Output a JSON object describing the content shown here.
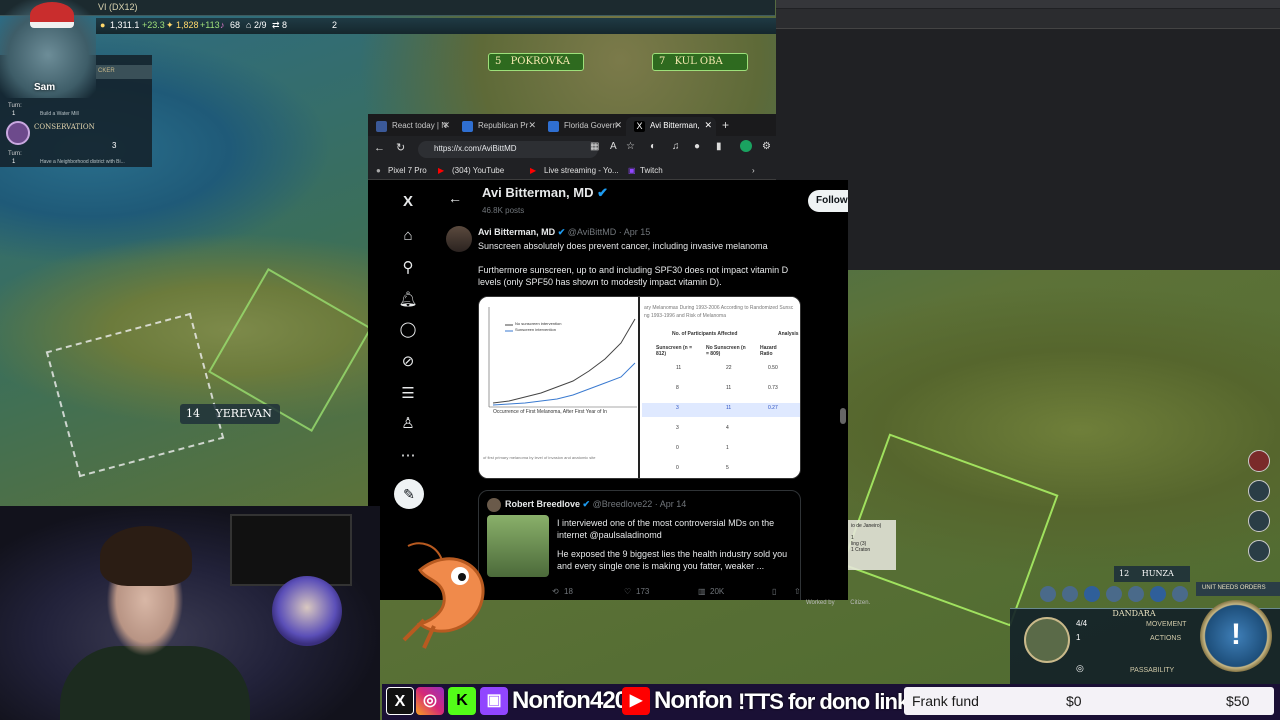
{
  "top_bar": {
    "window_title": "VI (DX12)",
    "gold": "1,311.1",
    "gold_rate": "+23.3",
    "faith": "1,828",
    "faith_rate": "+113",
    "culture": "68",
    "housing": "2/9",
    "trade": "8",
    "era": "2"
  },
  "left_panel": {
    "streamer": "Sam",
    "tracker_label": "CKER",
    "turn_label_1": "Turn:",
    "turn_value_1": "1",
    "task_1": "Build a Water Mill",
    "policy_title": "CONSERVATION",
    "policy_count": "3",
    "turn_label_2": "Turn:",
    "turn_value_2": "1",
    "task_2": "Have a Neighborhood district with Bi..."
  },
  "cities": {
    "pokrovka": {
      "pop": "5",
      "name": "POKROVKA"
    },
    "kul_oba": {
      "pop": "7",
      "name": "KUL OBA"
    },
    "yerevan": {
      "pop": "14",
      "name": "YEREVAN"
    },
    "hunza": {
      "pop": "12",
      "name": "HUNZA"
    }
  },
  "browser": {
    "tabs": [
      {
        "label": "React today | N",
        "color": "#3b5998"
      },
      {
        "label": "Republican Pr",
        "color": "#2f6fd1"
      },
      {
        "label": "Florida Govern",
        "color": "#2f6fd1"
      },
      {
        "label": "Avi Bitterman,",
        "color": "#000000"
      }
    ],
    "url": "https://x.com/AviBittMD",
    "bookmarks": [
      {
        "label": "Pixel 7 Pro"
      },
      {
        "label": "(304) YouTube"
      },
      {
        "label": "Live streaming - Yo..."
      },
      {
        "label": "Twitch"
      }
    ]
  },
  "profile": {
    "name": "Avi Bitterman, MD",
    "posts": "46.8K posts",
    "follow_label": "Follow"
  },
  "tweet": {
    "author": "Avi Bitterman, MD",
    "handle": "@AviBittMD · Apr 15",
    "line1": "Sunscreen absolutely does prevent cancer, including invasive melanoma",
    "line2": "Furthermore sunscreen, up to and including SPF30 does not impact vitamin D levels (only SPF50 has shown to modestly impact vitamin D).",
    "chart_caption": "Occurrence of First Melanoma, After First Year of In",
    "chart_legend_1": "No sunscreen intervention",
    "chart_legend_2": "Sunscreen intervention",
    "chart_footer": "of first primary melanoma by level of invasion and anatomic site",
    "table_title": "ary Melanomas During 1993-2006 According to Randomized Sunsc",
    "table_subtitle": "ng 1993-1996 and Risk of Melanoma",
    "table_header_group": "No. of Participants Affected",
    "table_header_analysis": "Analysis",
    "table_col_1": "Sunscreen (n = 812)",
    "table_col_2": "No Sunscreen (n = 809)",
    "table_col_3": "Hazard Ratio",
    "table_rows": [
      {
        "a": "11",
        "b": "22",
        "c": "0.50"
      },
      {
        "a": "8",
        "b": "11",
        "c": "0.73"
      },
      {
        "a": "3",
        "b": "11",
        "c": "0.27"
      },
      {
        "a": "3",
        "b": "4",
        "c": ""
      },
      {
        "a": "0",
        "b": "1",
        "c": ""
      },
      {
        "a": "0",
        "b": "5",
        "c": ""
      }
    ]
  },
  "quote_tweet": {
    "author": "Robert Breedlove",
    "handle": "@Breedlove22 · Apr 14",
    "text1": "I interviewed one of the most controversial MDs on the internet @paulsaladinomd",
    "text2": "He exposed the 9 biggest lies the health industry sold you and every single one is making you fatter, weaker ..."
  },
  "tweet_actions": {
    "replies": "18",
    "likes": "173",
    "views": "20K"
  },
  "game_hud": {
    "unit_name": "DANDARA",
    "movement": "4/4",
    "movement_label": "MOVEMENT",
    "actions": "1",
    "actions_label": "ACTIONS",
    "passability_label": "PASSABILITY",
    "needs_orders": "UNIT NEEDS ORDERS",
    "city_tooltip": [
      "io de Janeiro)",
      "1",
      "ling (3)",
      "1 Craton"
    ]
  },
  "stream_overlay": {
    "twitch_name": "Nonfon420",
    "youtube_name": "Nonfon",
    "tts_text": "!TTS for dono link",
    "fund_name": "Frank fund",
    "fund_current": "$0",
    "fund_goal": "$50",
    "worked_by": "Worked by",
    "citizen": "Citizen."
  }
}
